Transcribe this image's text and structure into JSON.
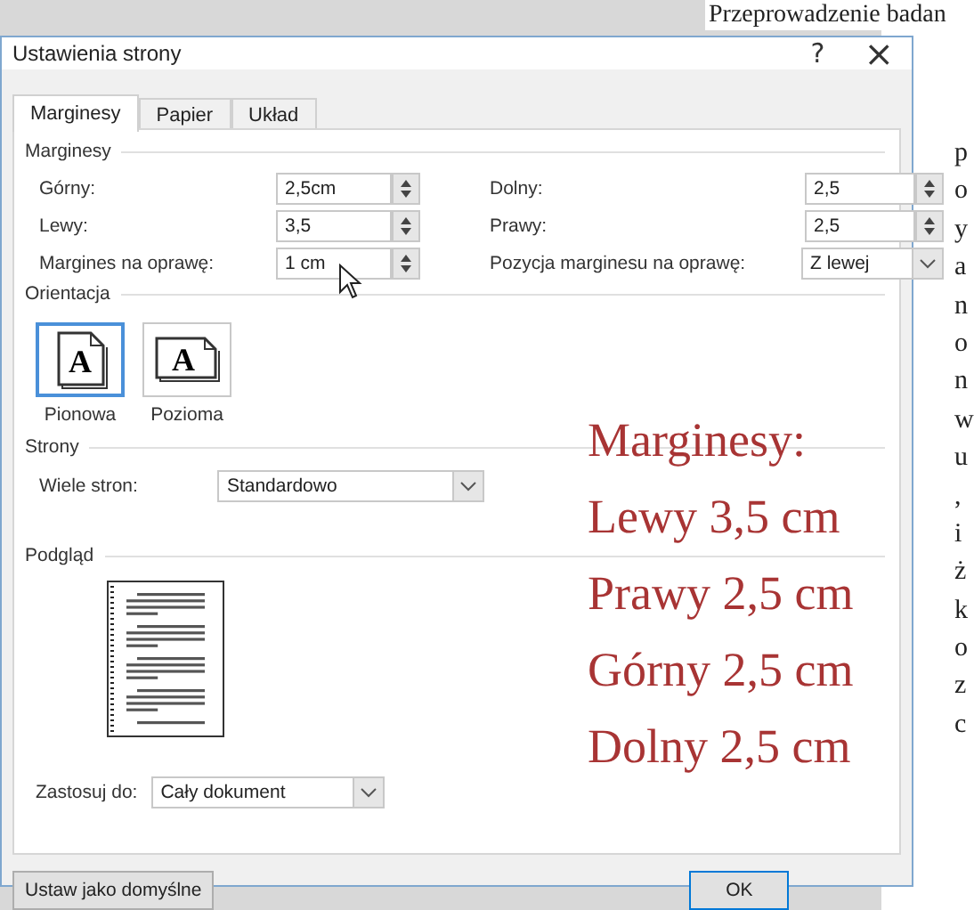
{
  "document": {
    "heading": "Przeprowadzenie  badan",
    "fragments": [
      "p",
      "o",
      "y",
      "a",
      "n",
      "o",
      "n",
      "w",
      "u",
      ",",
      "i",
      "ż",
      "k",
      "o",
      "z",
      "c"
    ]
  },
  "window": {
    "title": "Ustawienia strony",
    "help": "?",
    "close": "×"
  },
  "tabs": [
    {
      "label": "Marginesy",
      "selected": true
    },
    {
      "label": "Papier",
      "selected": false
    },
    {
      "label": "Układ",
      "selected": false
    }
  ],
  "margins": {
    "heading": "Marginesy",
    "fields": [
      {
        "label": "Górny:",
        "value": "2,5cm",
        "kind": "spin"
      },
      {
        "label": "Dolny:",
        "value": "2,5",
        "kind": "spin"
      },
      {
        "label": "Lewy:",
        "value": "3,5",
        "kind": "spin"
      },
      {
        "label": "Prawy:",
        "value": "2,5",
        "kind": "spin"
      },
      {
        "label": "Margines na oprawę:",
        "value": "1 cm",
        "kind": "spin"
      },
      {
        "label": "Pozycja marginesu na oprawę:",
        "value": "Z lewej",
        "kind": "select"
      }
    ]
  },
  "orientation": {
    "heading": "Orientacja",
    "options": [
      {
        "label": "Pionowa",
        "selected": true,
        "glyph": "A"
      },
      {
        "label": "Pozioma",
        "selected": false,
        "glyph": "A"
      }
    ]
  },
  "pages": {
    "heading": "Strony",
    "label": "Wiele stron:",
    "value": "Standardowo"
  },
  "preview": {
    "heading": "Podgląd",
    "apply_label": "Zastosuj do:",
    "apply_value": "Cały dokument"
  },
  "buttons": [
    "Ustaw jako domyślne",
    "OK"
  ],
  "overlay": [
    "Marginesy:",
    "Lewy 3,5 cm",
    "Prawy 2,5 cm",
    "Górny 2,5 cm",
    "Dolny 2,5 cm"
  ]
}
